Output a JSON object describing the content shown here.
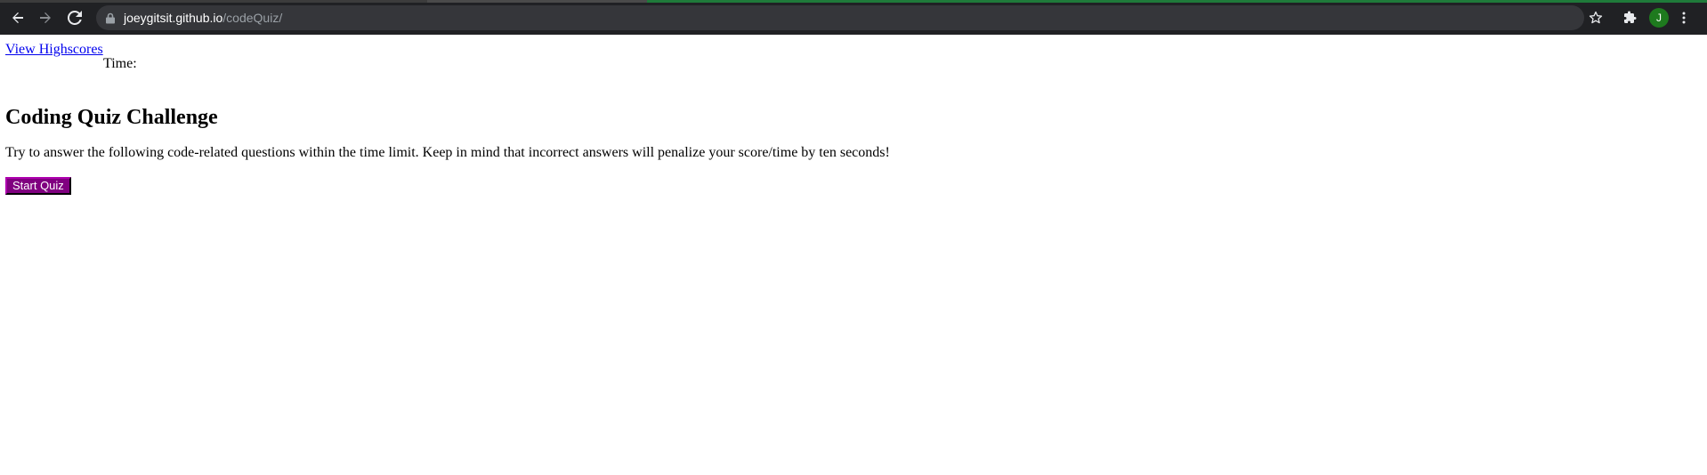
{
  "browser": {
    "url_host": "joeygitsit.github.io",
    "url_path": "/codeQuiz/",
    "profile_initial": "J",
    "icons": {
      "back": "arrow-left-icon",
      "forward": "arrow-right-icon",
      "reload": "reload-icon",
      "lock": "lock-icon",
      "bookmark": "star-icon",
      "extensions": "puzzle-icon",
      "menu": "kebab-menu-icon"
    },
    "colors": {
      "chrome_bg": "#202124",
      "omnibox_bg": "#35363a",
      "avatar_bg": "#1e7a1e"
    }
  },
  "page": {
    "highscores_link": "View Highscores",
    "timer_label": "Time:",
    "title": "Coding Quiz Challenge",
    "intro": "Try to answer the following code-related questions within the time limit. Keep in mind that incorrect answers will penalize your score/time by ten seconds!",
    "start_button": "Start Quiz",
    "colors": {
      "link": "#0000ee",
      "start_button_bg": "#800080"
    }
  }
}
